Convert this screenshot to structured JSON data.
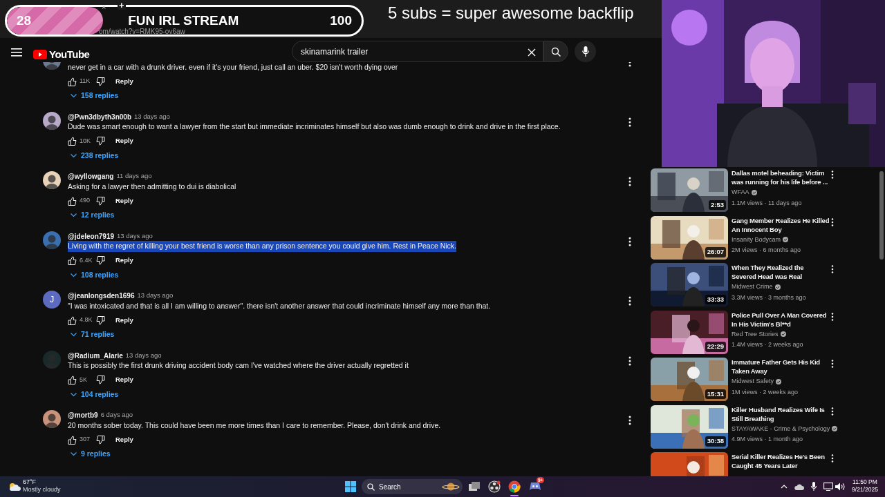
{
  "browser": {
    "tab_close": "×",
    "new_tab": "+",
    "url": "om/watch?v=RMK95-ov6aw"
  },
  "overlay": {
    "goal_bar": {
      "current": "28",
      "title": "FUN IRL STREAM",
      "target": "100",
      "level": 0.27
    },
    "banner": "5 subs = super awesome backflip"
  },
  "header": {
    "logo": "YouTube",
    "search": {
      "value": "skinamarink trailer"
    }
  },
  "comments": [
    {
      "text": "never get in a car with a drunk driver. even if it's your friend, just call an uber. $20 isn't worth dying over",
      "text_selected": false,
      "likes": "11K",
      "reply": "Reply",
      "replies": "158 replies"
    },
    {
      "author": "@Pwn3dbyth3n00b",
      "time": "13 days ago",
      "text": "Dude was smart enough to want a lawyer from the start but immediate incriminates himself but also was dumb enough to drink and drive in the first place.",
      "text_selected": false,
      "likes": "10K",
      "reply": "Reply",
      "replies": "238 replies"
    },
    {
      "author": "@wyllowgang",
      "time": "11 days ago",
      "text": "Asking for a lawyer then admitting to dui is diabolical",
      "text_selected": false,
      "likes": "490",
      "reply": "Reply",
      "replies": "12 replies"
    },
    {
      "author": "@jdeleon7919",
      "time": "13 days ago",
      "text": "Living with the regret of killing your best friend is worse than any prison sentence you could give him. Rest in Peace Nick.",
      "text_selected": true,
      "likes": "6.4K",
      "reply": "Reply",
      "replies": "108 replies"
    },
    {
      "avatar": {
        "kind": "letter",
        "letter": "J",
        "color": "#5c6bc0"
      },
      "author": "@jeanlongsden1696",
      "time": "13 days ago",
      "text": "\"I was intoxicated and that is all I am willing to answer\". there isn't another answer that could incriminate himself any more than that.",
      "text_selected": false,
      "likes": "4.8K",
      "reply": "Reply",
      "replies": "71 replies"
    },
    {
      "author": "@Radium_Alarie",
      "time": "13 days ago",
      "text": "This is possibly the first drunk driving accident body cam I've watched where the driver actually regretted it",
      "text_selected": false,
      "likes": "5K",
      "reply": "Reply",
      "replies": "104 replies"
    },
    {
      "author": "@mortb9",
      "time": "6 days ago",
      "text": "20 months sober today.  This could have been me more times than I care to remember.  Please, don't drink and drive.",
      "text_selected": false,
      "likes": "307",
      "reply": "Reply",
      "replies": "9 replies"
    }
  ],
  "recommended": [
    {
      "title": "Dallas motel beheading: Victim was running for his life before ...",
      "channel": "WFAA",
      "verified": true,
      "meta": "1.1M views · 11 days ago",
      "duration": "2:53"
    },
    {
      "title": "Gang Member Realizes He Killed An Innocent Boy",
      "channel": "Insanity Bodycam",
      "verified": true,
      "meta": "2M views · 6 months ago",
      "duration": "26:07"
    },
    {
      "title": "When They Realized the Severed Head was Real",
      "channel": "Midwest Crime",
      "verified": true,
      "meta": "3.3M views · 3 months ago",
      "duration": "33:33"
    },
    {
      "title": "Police Pull Over A Man Covered In His Victim's Bl**d",
      "channel": "Red Tree Stories",
      "verified": true,
      "meta": "1.4M views · 2 weeks ago",
      "duration": "22:29"
    },
    {
      "title": "Immature Father Gets His Kid Taken Away",
      "channel": "Midwest Safety",
      "verified": true,
      "meta": "1M views · 2 weeks ago",
      "duration": "15:31"
    },
    {
      "title": "Killer Husband Realizes Wife Is Still Breathing",
      "channel": "STAYAWAKE - Crime & Psychology",
      "verified": true,
      "meta": "4.9M views · 1 month ago",
      "duration": "30:38"
    },
    {
      "title": "Serial Killer Realizes He's Been Caught 45 Years Later"
    }
  ],
  "taskbar": {
    "weather": {
      "temp": "67°F",
      "condition": "Mostly cloudy"
    },
    "search": "Search",
    "discord_badge": "9+",
    "time": "11:50 PM",
    "date": "9/21/2025"
  }
}
